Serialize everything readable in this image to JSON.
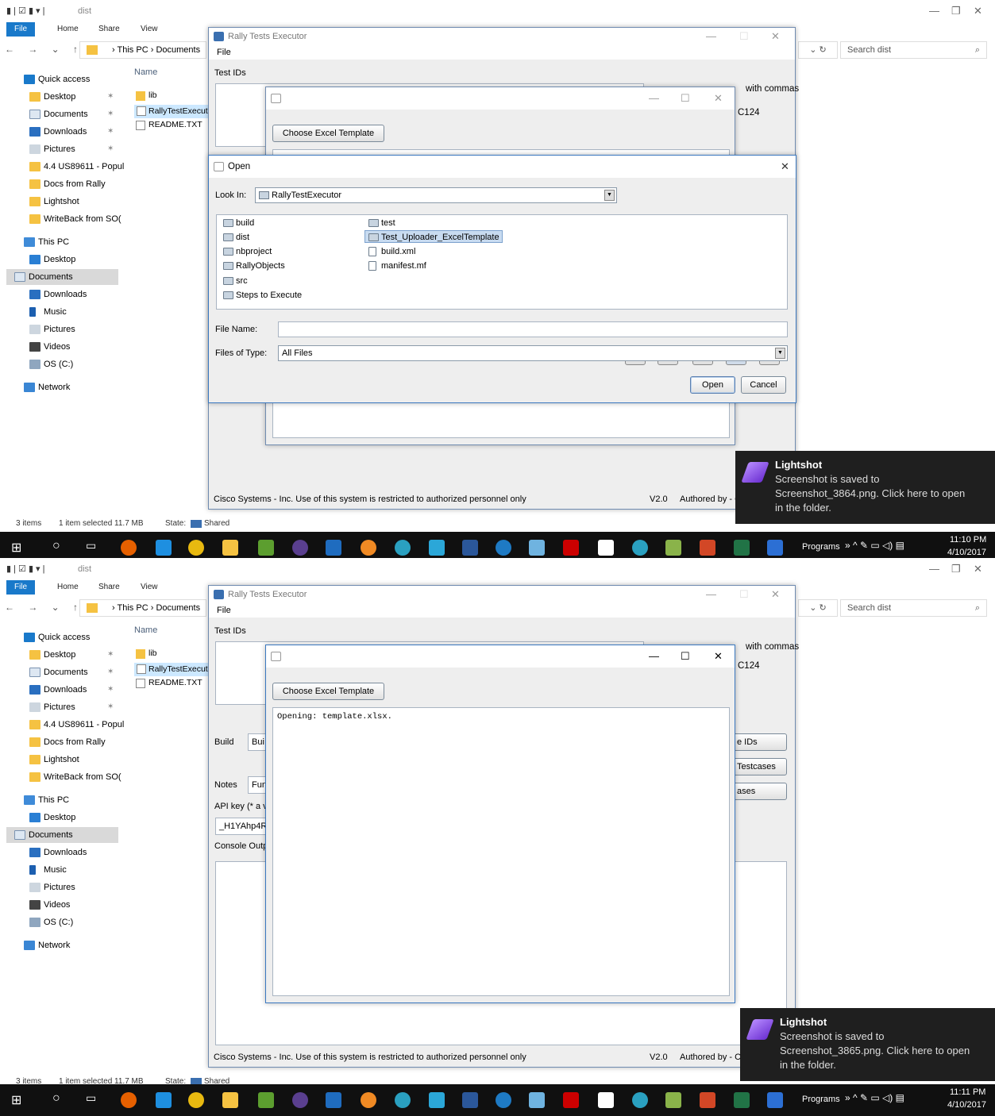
{
  "explorer": {
    "title": "dist",
    "ribbon_tabs": [
      "File",
      "Home",
      "Share",
      "View"
    ],
    "breadcrumb": [
      "This PC",
      "Documents"
    ],
    "search_placeholder": "Search dist",
    "column_name": "Name",
    "quick_access": "Quick access",
    "nav_items": [
      "Desktop",
      "Documents",
      "Downloads",
      "Pictures",
      "4.4 US89611 - Popul",
      "Docs from Rally",
      "Lightshot",
      "WriteBack from SO("
    ],
    "this_pc": "This PC",
    "pc_items": [
      "Desktop",
      "Documents",
      "Downloads",
      "Music",
      "Pictures",
      "Videos",
      "OS (C:)"
    ],
    "network": "Network",
    "files": [
      "lib",
      "RallyTestExecut",
      "README.TXT"
    ],
    "status_items": "3 items",
    "status_selected": "1 item selected  11.7 MB",
    "status_state": "State:",
    "status_shared": "Shared"
  },
  "rally": {
    "title": "Rally Tests Executor",
    "menu_file": "File",
    "test_ids_label": "Test IDs",
    "hint_right": "with commas",
    "hint_right2": "C124",
    "build_label": "Build",
    "build_value": "Bui",
    "notes_label": "Notes",
    "notes_value": "Fun",
    "api_label": "API key (* a va",
    "api_value": "_H1YAhp4R",
    "console_label": "Console Outp",
    "btn1": "e IDs",
    "btn2": "Testcases",
    "btn3": "ases",
    "footer": "Cisco Systems - Inc. Use of this system is restricted to authorized personnel only",
    "version": "V2.0",
    "authored": "Authored by - C"
  },
  "excel_dialog": {
    "choose_button": "Choose Excel Template",
    "console_text": "Opening: template.xlsx."
  },
  "open_dialog": {
    "title": "Open",
    "look_in_label": "Look In:",
    "look_in_value": "RallyTestExecutor",
    "col1": [
      "build",
      "dist",
      "nbproject",
      "RallyObjects",
      "src",
      "Steps to Execute"
    ],
    "col2": [
      "test",
      "Test_Uploader_ExcelTemplate",
      "build.xml",
      "manifest.mf"
    ],
    "file_name_label": "File Name:",
    "file_name_value": "",
    "files_of_type_label": "Files of Type:",
    "files_of_type_value": "All Files",
    "open_button": "Open",
    "cancel_button": "Cancel"
  },
  "toast1": {
    "title": "Lightshot",
    "line1": "Screenshot is saved to",
    "line2": "Screenshot_3864.png. Click here to open",
    "line3": "in the folder."
  },
  "toast2": {
    "title": "Lightshot",
    "line1": "Screenshot is saved to",
    "line2": "Screenshot_3865.png. Click here to open",
    "line3": "in the folder."
  },
  "taskbar1": {
    "programs": "Programs",
    "time": "11:10 PM",
    "date": "4/10/2017"
  },
  "taskbar2": {
    "programs": "Programs",
    "time": "11:11 PM",
    "date": "4/10/2017"
  },
  "colors": {
    "accent": "#1979ca",
    "taskbar": "#101010",
    "toast": "#1f1f1f",
    "folder": "#f5c242"
  }
}
